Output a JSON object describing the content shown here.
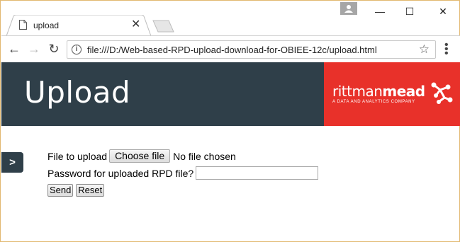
{
  "browser": {
    "tab_title": "upload",
    "tab_close": "✕",
    "url": "file:///D:/Web-based-RPD-upload-download-for-OBIEE-12c/upload.html",
    "back": "←",
    "forward": "→",
    "reload": "↻",
    "star": "☆",
    "menu": "⋮",
    "minimize": "—",
    "maximize": "☐",
    "close": "✕"
  },
  "banner": {
    "title": "Upload",
    "brand_light": "rittman",
    "brand_bold": "mead",
    "brand_tagline": "A DATA AND ANALYTICS COMPANY"
  },
  "side_toggle": ">",
  "form": {
    "file_label": "File to upload",
    "choose_file": "Choose file",
    "no_file": "No file chosen",
    "password_label": "Password for uploaded RPD file?",
    "password_value": "",
    "send": "Send",
    "reset": "Reset"
  },
  "colors": {
    "banner_bg": "#2f3f49",
    "brand_red": "#e8312a"
  }
}
